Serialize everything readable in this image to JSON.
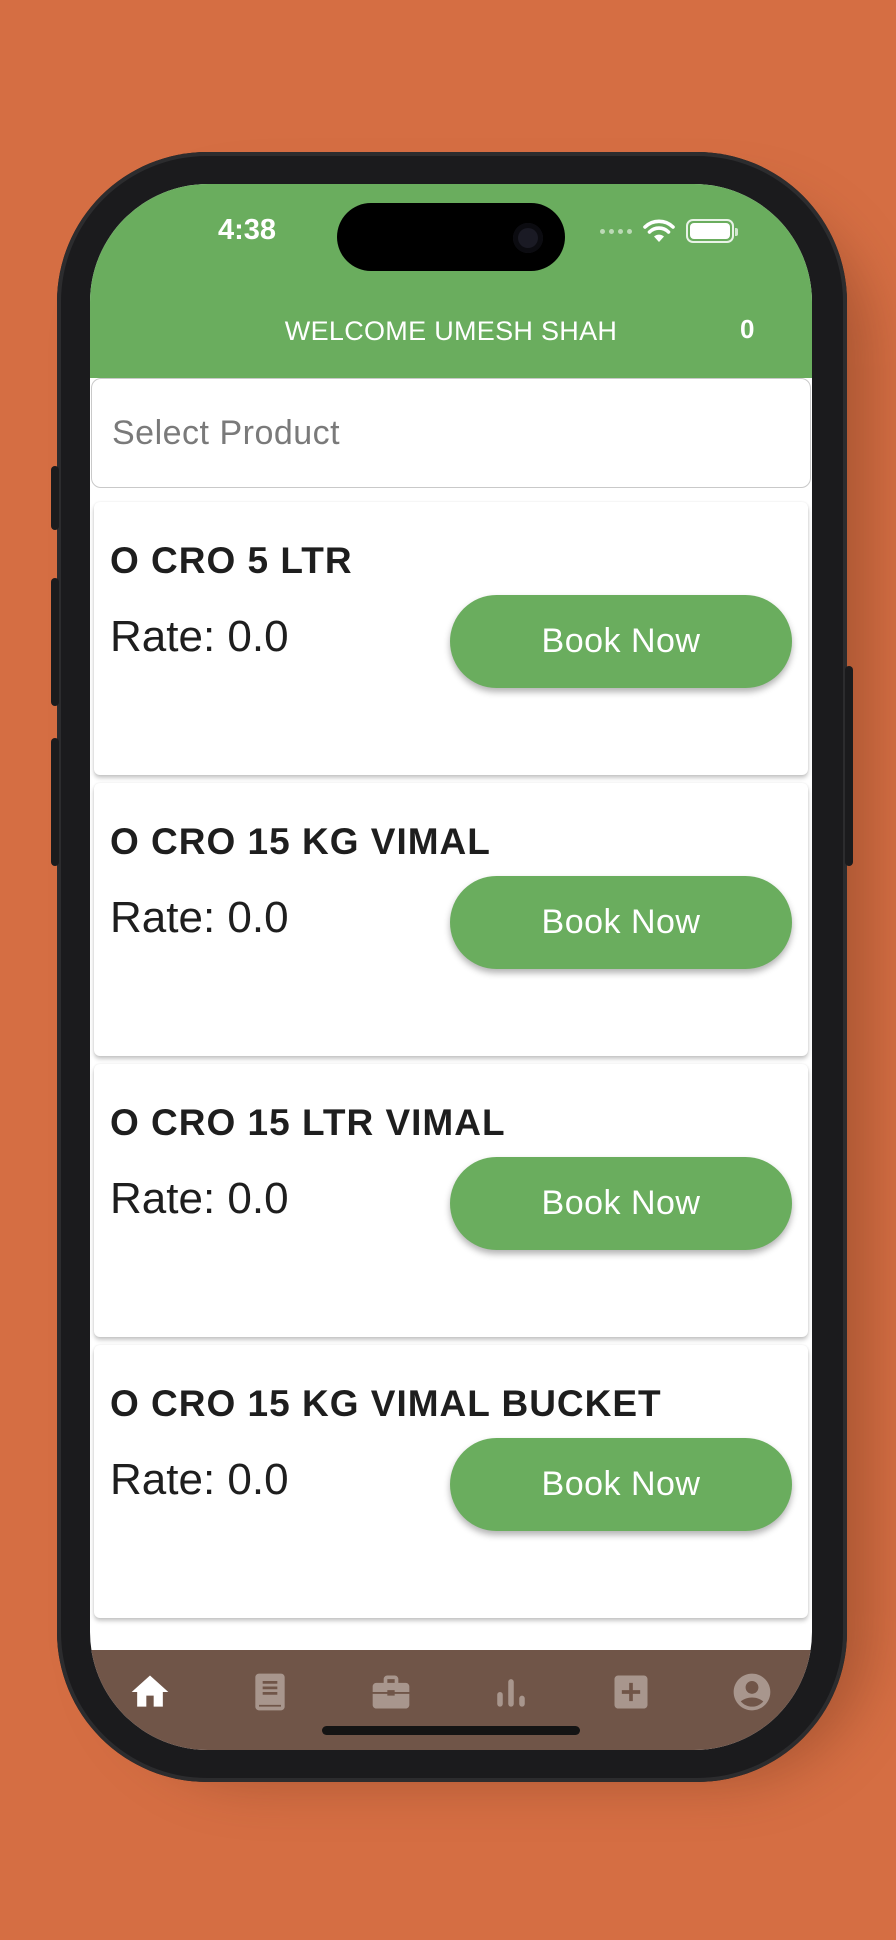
{
  "status_bar": {
    "time": "4:38"
  },
  "header": {
    "title": "WELCOME UMESH SHAH",
    "cart_count": "0"
  },
  "search": {
    "placeholder": "Select Product"
  },
  "products": [
    {
      "name": "O CRO 5 LTR",
      "rate": "Rate: 0.0",
      "button": "Book Now"
    },
    {
      "name": "O CRO 15 KG VIMAL",
      "rate": "Rate: 0.0",
      "button": "Book Now"
    },
    {
      "name": "O CRO 15 LTR VIMAL",
      "rate": "Rate: 0.0",
      "button": "Book Now"
    },
    {
      "name": "O CRO 15 KG VIMAL BUCKET",
      "rate": "Rate: 0.0",
      "button": "Book Now"
    }
  ],
  "bottom_nav": [
    {
      "icon": "home-icon",
      "active": true
    },
    {
      "icon": "book-icon",
      "active": false
    },
    {
      "icon": "briefcase-icon",
      "active": false
    },
    {
      "icon": "bar-chart-icon",
      "active": false
    },
    {
      "icon": "add-box-icon",
      "active": false
    },
    {
      "icon": "account-icon",
      "active": false
    }
  ],
  "colors": {
    "background": "#d56e43",
    "primary_green": "#6aad5e",
    "nav_brown": "#705548",
    "nav_active": "#ffffff",
    "nav_inactive": "#a8968d"
  }
}
